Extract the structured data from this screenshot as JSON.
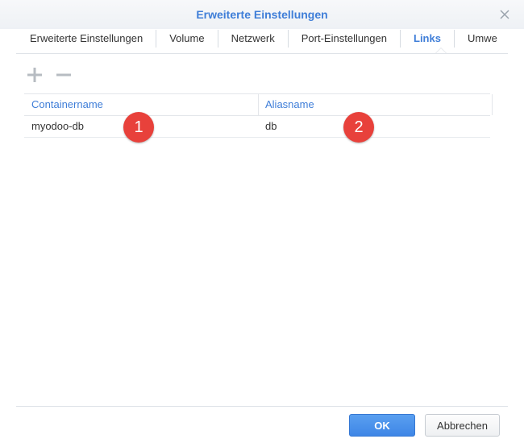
{
  "window": {
    "title": "Erweiterte Einstellungen"
  },
  "tabs": [
    {
      "label": "Erweiterte Einstellungen",
      "active": false
    },
    {
      "label": "Volume",
      "active": false
    },
    {
      "label": "Netzwerk",
      "active": false
    },
    {
      "label": "Port-Einstellungen",
      "active": false
    },
    {
      "label": "Links",
      "active": true
    },
    {
      "label": "Umwe",
      "active": false
    }
  ],
  "toolbar": {
    "add_icon": "plus-icon",
    "remove_icon": "minus-icon"
  },
  "grid": {
    "columns": [
      "Containername",
      "Aliasname"
    ],
    "rows": [
      {
        "containername": "myodoo-db",
        "aliasname": "db"
      }
    ]
  },
  "annotations": [
    "1",
    "2"
  ],
  "footer": {
    "ok_label": "OK",
    "cancel_label": "Abbrechen"
  },
  "colors": {
    "accent": "#3f7ed8",
    "badge": "#e8413b",
    "ok_button": "#4a90e8"
  }
}
